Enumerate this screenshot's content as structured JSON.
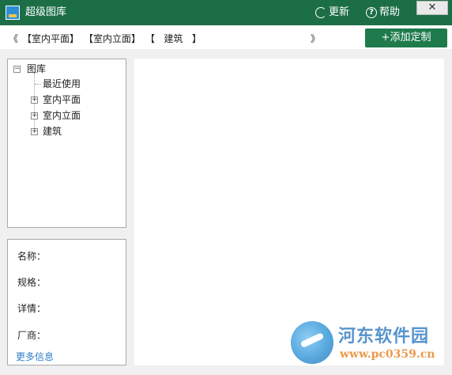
{
  "window": {
    "title": "超级图库",
    "refresh_label": "更新",
    "help_label": "帮助",
    "close_glyph": "✕"
  },
  "toolbar": {
    "prev_glyph": "《",
    "next_glyph": "》",
    "crumbs": [
      "【室内平面】",
      "【室内立面】",
      "【   建筑   】"
    ],
    "add_label": "+添加定制"
  },
  "tree": {
    "root": "图库",
    "items": [
      {
        "label": "最近使用",
        "expandable": false
      },
      {
        "label": "室内平面",
        "expandable": true
      },
      {
        "label": "室内立面",
        "expandable": true
      },
      {
        "label": "建筑",
        "expandable": true
      }
    ]
  },
  "info": {
    "name_label": "名称：",
    "spec_label": "规格：",
    "detail_label": "详情：",
    "vendor_label": "厂商：",
    "more_label": "更多信息"
  },
  "watermark": {
    "brand": "河东软件园",
    "url": "www.pc0359.cn"
  },
  "colors": {
    "titlebar": "#1c6e47",
    "accent_button": "#1f7a4c",
    "link": "#2f7fc9"
  }
}
